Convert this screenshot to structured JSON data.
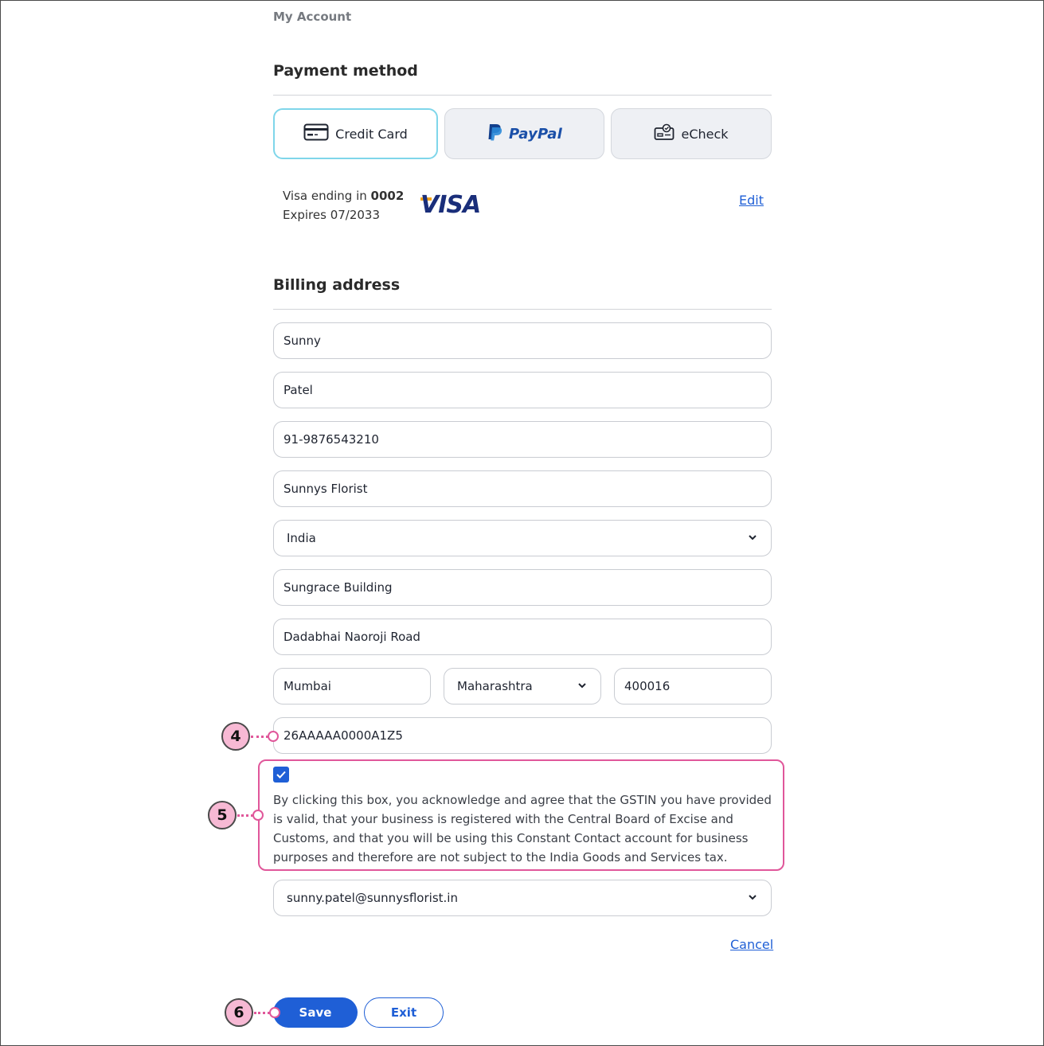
{
  "breadcrumb": "My Account",
  "payment": {
    "title": "Payment method",
    "methods": [
      {
        "label": "Credit Card",
        "icon": "credit-card-icon",
        "selected": true
      },
      {
        "label": "PayPal",
        "icon": "paypal-logo-icon",
        "selected": false
      },
      {
        "label": "eCheck",
        "icon": "echeck-icon",
        "selected": false
      }
    ],
    "card": {
      "line1_prefix": "Visa ending in ",
      "last4": "0002",
      "expires": "Expires 07/2033",
      "brand": "VISA",
      "edit_label": "Edit"
    }
  },
  "billing": {
    "title": "Billing address",
    "first_name": "Sunny",
    "last_name": "Patel",
    "phone": "91-9876543210",
    "company": "Sunnys Florist",
    "country": "India",
    "address1": "Sungrace Building",
    "address2": "Dadabhai Naoroji Road",
    "city": "Mumbai",
    "state": "Maharashtra",
    "postal": "400016",
    "gstin": "26AAAAA0000A1Z5",
    "consent_checked": true,
    "consent_text": "By clicking this box, you acknowledge and agree that the GSTIN you have provided is valid, that your business is registered with the Central Board of Excise and Customs, and that you will be using this Constant Contact account for business purposes and therefore are not subject to the India Goods and Services tax.",
    "email": "sunny.patel@sunnysflorist.in"
  },
  "actions": {
    "cancel_label": "Cancel",
    "save_label": "Save",
    "exit_label": "Exit"
  },
  "callouts": {
    "c4": "4",
    "c5": "5",
    "c6": "6"
  },
  "colors": {
    "accent": "#1f5fd6",
    "callout_pink": "#e0579a",
    "selected_border": "#7fd6ea"
  }
}
